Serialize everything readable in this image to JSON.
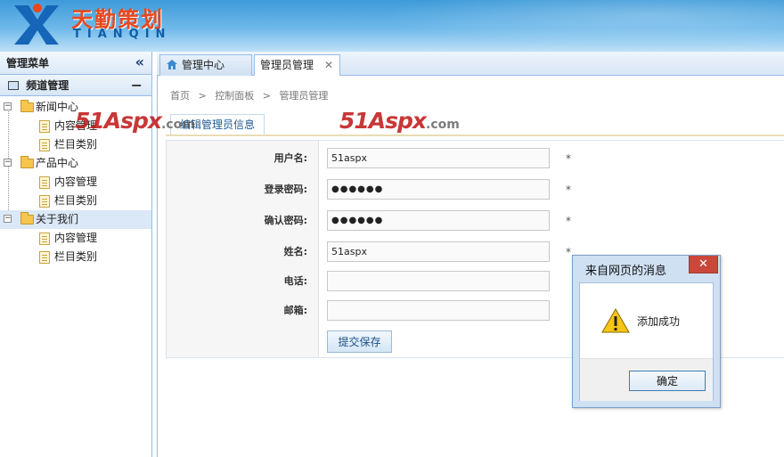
{
  "header": {
    "logo_cn": "天勤策划",
    "logo_en": "TIANQIN"
  },
  "sidebar": {
    "title": "管理菜单",
    "panel_title": "频道管理",
    "tree": [
      {
        "label": "新闻中心",
        "children": [
          "内容管理",
          "栏目类别"
        ]
      },
      {
        "label": "产品中心",
        "children": [
          "内容管理",
          "栏目类别"
        ]
      },
      {
        "label": "关于我们",
        "children": [
          "内容管理",
          "栏目类别"
        ],
        "selected": true
      }
    ]
  },
  "tabs": [
    {
      "label": "管理中心",
      "icon": "home-icon"
    },
    {
      "label": "管理员管理",
      "active": true
    }
  ],
  "breadcrumb": [
    "首页",
    ">",
    "控制面板",
    ">",
    "管理员管理"
  ],
  "subtab": "编辑管理员信息",
  "form": {
    "username_label": "用户名:",
    "username_value": "51aspx",
    "password_label": "登录密码:",
    "password_value": "●●●●●●",
    "confirm_label": "确认密码:",
    "confirm_value": "●●●●●●",
    "name_label": "姓名:",
    "name_value": "51aspx",
    "phone_label": "电话:",
    "phone_value": "",
    "email_label": "邮箱:",
    "email_value": "",
    "required_mark": "*",
    "submit_label": "提交保存"
  },
  "watermark": {
    "main": "51Aspx",
    "suffix": ".com"
  },
  "dialog": {
    "title": "来自网页的消息",
    "close": "✕",
    "message": "添加成功",
    "ok_label": "确定"
  }
}
